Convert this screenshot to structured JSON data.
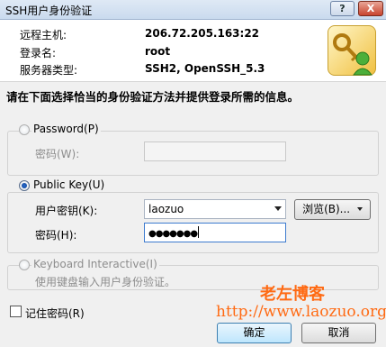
{
  "window": {
    "title": "SSH用户身份验证",
    "help_label": "?",
    "close_label": "X"
  },
  "connection": {
    "host_label": "远程主机:",
    "host_value": "206.72.205.163:22",
    "login_label": "登录名:",
    "login_value": "root",
    "server_type_label": "服务器类型:",
    "server_type_value": "SSH2, OpenSSH_5.3"
  },
  "instruction": "请在下面选择恰当的身份验证方法并提供登录所需的信息。",
  "password_method": {
    "label": "Password(P)",
    "selected": false,
    "enabled": false,
    "field_label": "密码(W):",
    "field_value": ""
  },
  "publickey_method": {
    "label": "Public Key(U)",
    "selected": true,
    "key_label": "用户密钥(K):",
    "key_value": "laozuo",
    "browse_label": "浏览(B)...",
    "passphrase_label": "密码(H):",
    "passphrase_value": "●●●●●●●"
  },
  "keyboard_method": {
    "label": "Keyboard Interactive(I)",
    "enabled": false,
    "description": "使用键盘输入用户身份验证。"
  },
  "remember_password": {
    "label": "记住密码(R)",
    "checked": false
  },
  "watermark": {
    "name": "老左博客",
    "url": "http://www.laozuo.org"
  },
  "buttons": {
    "ok_label": "确定",
    "cancel_label": "取消"
  },
  "colors": {
    "watermark": "#ff6a13",
    "dialog_bg": "#f0f0f0",
    "radio_selected": "#0b3f8f"
  },
  "icons": {
    "header_icon": "keys-user-icon",
    "dropdown_icon": "chevron-down-icon"
  }
}
